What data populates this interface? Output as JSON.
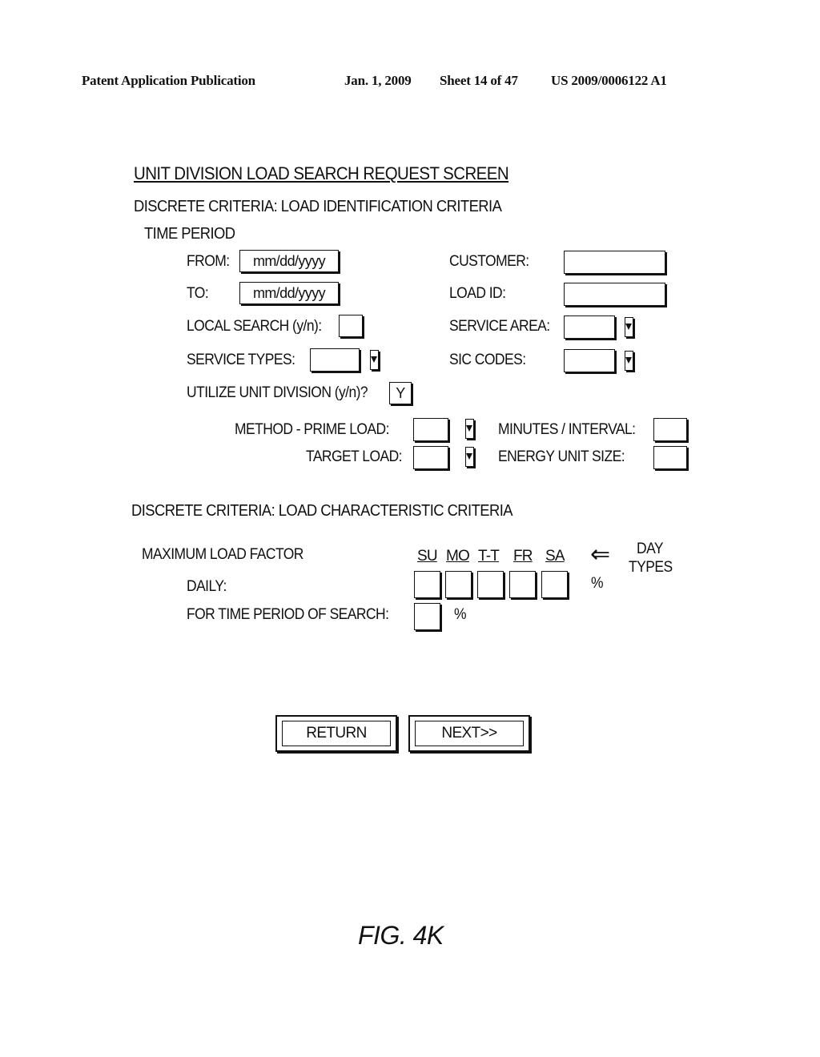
{
  "header": {
    "publication": "Patent Application Publication",
    "date": "Jan. 1, 2009",
    "sheet": "Sheet 14 of 47",
    "number": "US 2009/0006122 A1"
  },
  "screen": {
    "title": "UNIT DIVISION LOAD SEARCH REQUEST SCREEN",
    "section1": "DISCRETE CRITERIA: LOAD IDENTIFICATION CRITERIA",
    "time_period": "TIME PERIOD",
    "from_label": "FROM:",
    "from_value": "mm/dd/yyyy",
    "to_label": "TO:",
    "to_value": "mm/dd/yyyy",
    "local_search_label": "LOCAL SEARCH (y/n):",
    "local_search_value": "",
    "service_types_label": "SERVICE TYPES:",
    "service_types_value": "",
    "utilize_label": "UTILIZE UNIT DIVISION (y/n)?",
    "utilize_value": "Y",
    "customer_label": "CUSTOMER:",
    "customer_value": "",
    "load_id_label": "LOAD ID:",
    "load_id_value": "",
    "service_area_label": "SERVICE AREA:",
    "service_area_value": "",
    "sic_codes_label": "SIC CODES:",
    "sic_codes_value": "",
    "method_prime_label": "METHOD - PRIME LOAD:",
    "method_prime_value": "",
    "target_load_label": "TARGET LOAD:",
    "target_load_value": "",
    "minutes_interval_label": "MINUTES / INTERVAL:",
    "minutes_interval_value": "",
    "energy_unit_label": "ENERGY UNIT SIZE:",
    "energy_unit_value": "",
    "section2": "DISCRETE CRITERIA: LOAD CHARACTERISTIC CRITERIA",
    "max_load_factor": "MAXIMUM LOAD FACTOR",
    "day_types": [
      "SU",
      "MO",
      "T-T",
      "FR",
      "SA"
    ],
    "arrow": "⇐",
    "day_types_label_1": "DAY",
    "day_types_label_2": "TYPES",
    "daily_label": "DAILY:",
    "daily_unit": "%",
    "period_label": "FOR TIME PERIOD OF SEARCH:",
    "period_unit": "%",
    "return_button": "RETURN",
    "next_button": "NEXT>>"
  },
  "figure_label": "FIG. 4K",
  "icons": {
    "dropdown": "chevron-down-icon"
  }
}
